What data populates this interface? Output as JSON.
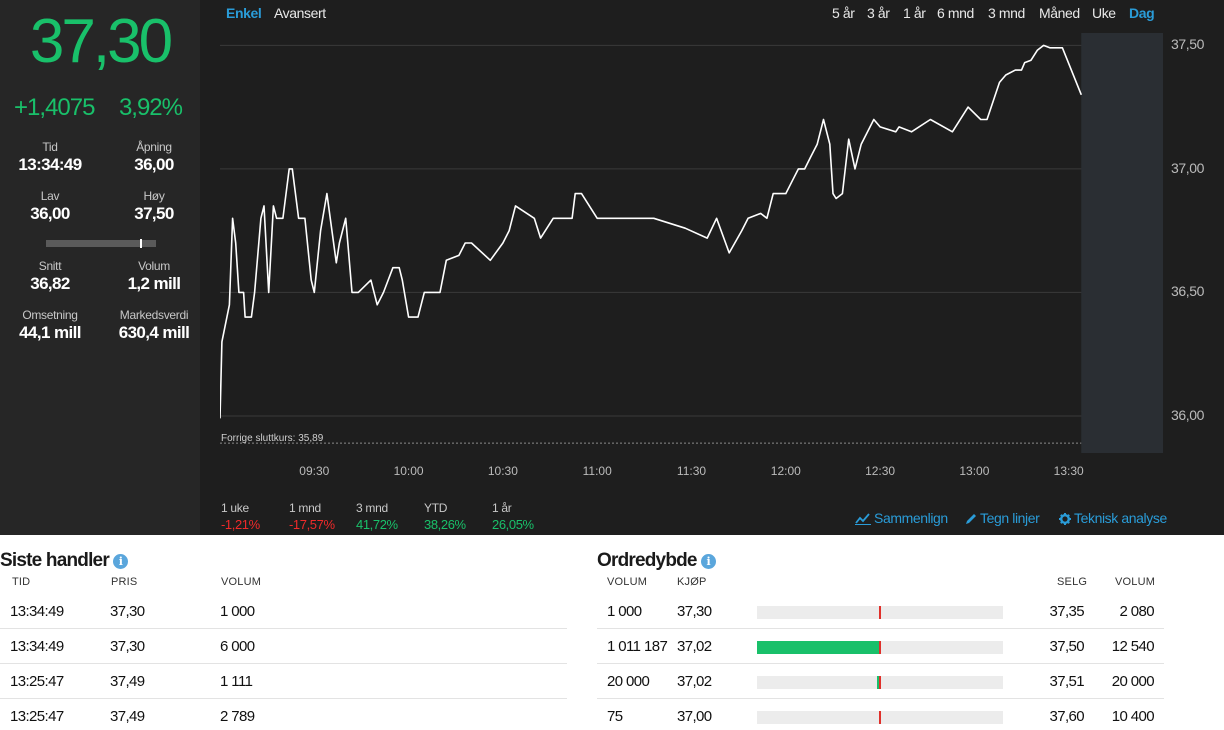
{
  "quote": {
    "last": "37,30",
    "change_abs": "+1,4075",
    "change_pct": "3,92%",
    "time_label": "Tid",
    "time_value": "13:34:49",
    "open_label": "Åpning",
    "open_value": "36,00",
    "low_label": "Lav",
    "low_value": "36,00",
    "high_label": "Høy",
    "high_value": "37,50",
    "avg_label": "Snitt",
    "avg_value": "36,82",
    "volume_label": "Volum",
    "volume_value": "1,2 mill",
    "turnover_label": "Omsetning",
    "turnover_value": "44,1 mill",
    "mcap_label": "Markedsverdi",
    "mcap_value": "630,4 mill",
    "day_range_position": 0.87
  },
  "chart_tabs": {
    "simple": "Enkel",
    "advanced": "Avansert",
    "periods": [
      "5 år",
      "3 år",
      "1 år",
      "6 mnd",
      "3 mnd",
      "Måned",
      "Uke",
      "Dag"
    ],
    "active_period": "Dag"
  },
  "chart_data": {
    "type": "line",
    "prev_close_label": "Forrige sluttkurs: 35,89",
    "prev_close": 35.89,
    "ylim": [
      35.85,
      37.55
    ],
    "yticks": [
      "37,50",
      "37,00",
      "36,50",
      "36,00"
    ],
    "ytick_values": [
      37.5,
      37.0,
      36.5,
      36.0
    ],
    "xticks": [
      "09:30",
      "10:00",
      "10:30",
      "11:00",
      "11:30",
      "12:00",
      "12:30",
      "13:00",
      "13:30"
    ],
    "xtick_minutes": [
      30,
      60,
      90,
      120,
      150,
      180,
      210,
      240,
      270
    ],
    "xlim_minutes": [
      0,
      300
    ],
    "shaded_from_minute": 274,
    "series": [
      {
        "x": [
          0,
          0.6,
          3,
          4,
          5,
          6,
          7.5,
          8,
          10,
          11,
          13,
          14,
          15.5,
          17,
          18,
          20,
          22,
          23,
          25,
          26,
          27,
          29,
          30,
          32,
          34,
          37,
          38,
          40,
          42,
          44,
          48,
          50,
          52,
          55,
          57,
          58,
          60,
          63,
          65,
          66,
          68,
          70,
          72,
          76,
          78,
          80,
          86,
          90,
          92,
          94,
          100,
          102,
          106,
          112,
          113,
          115,
          120,
          122,
          124,
          127,
          130,
          138,
          148,
          155,
          158,
          162,
          166,
          168,
          172,
          174,
          176,
          180,
          182,
          184,
          186,
          188,
          190,
          192,
          194,
          195,
          196,
          198,
          200,
          202,
          204,
          208,
          210,
          215,
          216,
          220,
          226,
          233,
          238,
          242,
          244,
          248,
          250,
          253,
          255,
          256,
          258,
          260,
          262,
          264,
          268,
          274
        ],
        "y": [
          35.99,
          36.3,
          36.45,
          36.8,
          36.7,
          36.5,
          36.5,
          36.4,
          36.4,
          36.5,
          36.8,
          36.85,
          36.5,
          36.85,
          36.8,
          36.8,
          37.0,
          37.0,
          36.8,
          36.8,
          36.8,
          36.55,
          36.5,
          36.75,
          36.9,
          36.62,
          36.7,
          36.8,
          36.5,
          36.5,
          36.55,
          36.45,
          36.5,
          36.6,
          36.6,
          36.55,
          36.4,
          36.4,
          36.5,
          36.5,
          36.5,
          36.5,
          36.63,
          36.65,
          36.7,
          36.7,
          36.63,
          36.7,
          36.75,
          36.85,
          36.8,
          36.72,
          36.8,
          36.8,
          36.9,
          36.9,
          36.8,
          36.8,
          36.8,
          36.8,
          36.8,
          36.8,
          36.76,
          36.72,
          36.8,
          36.66,
          36.75,
          36.8,
          36.82,
          36.8,
          36.9,
          36.9,
          36.95,
          37.0,
          37.0,
          37.05,
          37.1,
          37.2,
          37.1,
          36.9,
          36.88,
          36.9,
          37.12,
          37.0,
          37.1,
          37.2,
          37.17,
          37.15,
          37.17,
          37.15,
          37.2,
          37.15,
          37.25,
          37.2,
          37.2,
          37.35,
          37.38,
          37.4,
          37.4,
          37.43,
          37.44,
          37.48,
          37.5,
          37.49,
          37.49,
          37.3
        ]
      }
    ]
  },
  "performance": [
    {
      "label": "1 uke",
      "value": "-1,21%",
      "sign": "neg"
    },
    {
      "label": "1 mnd",
      "value": "-17,57%",
      "sign": "neg"
    },
    {
      "label": "3 mnd",
      "value": "41,72%",
      "sign": "pos"
    },
    {
      "label": "YTD",
      "value": "38,26%",
      "sign": "pos"
    },
    {
      "label": "1 år",
      "value": "26,05%",
      "sign": "pos"
    }
  ],
  "tools": {
    "compare": "Sammenlign",
    "draw": "Tegn linjer",
    "technical": "Teknisk analyse"
  },
  "trades": {
    "title": "Siste handler",
    "info": "i",
    "headers": {
      "time": "TID",
      "price": "PRIS",
      "volume": "VOLUM"
    },
    "rows": [
      {
        "time": "13:34:49",
        "price": "37,30",
        "volume": "1 000"
      },
      {
        "time": "13:34:49",
        "price": "37,30",
        "volume": "6 000"
      },
      {
        "time": "13:25:47",
        "price": "37,49",
        "volume": "1 111"
      },
      {
        "time": "13:25:47",
        "price": "37,49",
        "volume": "2 789"
      }
    ]
  },
  "orderbook": {
    "title": "Ordredybde",
    "info": "i",
    "headers": {
      "bid_volume": "VOLUM",
      "bid": "KJØP",
      "ask": "SELG",
      "ask_volume": "VOLUM"
    },
    "rows": [
      {
        "bid_volume": "1 000",
        "bid": "37,30",
        "ask": "37,35",
        "ask_volume": "2 080",
        "bid_share": 0.0,
        "ask_share": 0.0
      },
      {
        "bid_volume": "1 011 187",
        "bid": "37,02",
        "ask": "37,50",
        "ask_volume": "12 540",
        "bid_share": 1.0,
        "ask_share": 0.0
      },
      {
        "bid_volume": "20 000",
        "bid": "37,02",
        "ask": "37,51",
        "ask_volume": "20 000",
        "bid_share": 0.02,
        "ask_share": 0.0
      },
      {
        "bid_volume": "75",
        "bid": "37,00",
        "ask": "37,60",
        "ask_volume": "10 400",
        "bid_share": 0.0,
        "ask_share": 0.0
      }
    ]
  },
  "colors": {
    "up": "#19c06a",
    "down": "#f02a2a",
    "accent": "#2a9cd8",
    "line": "#ffffff"
  }
}
